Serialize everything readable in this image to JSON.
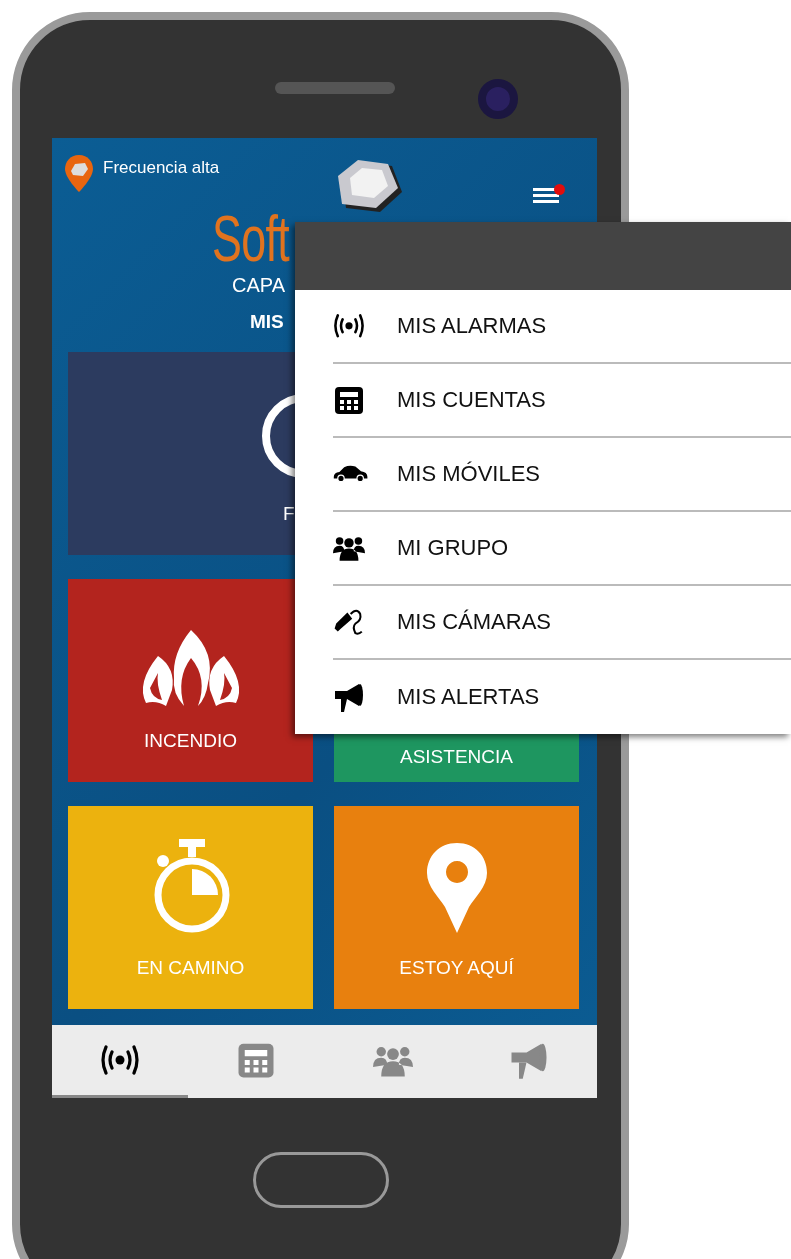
{
  "status": {
    "text": "Frecuencia alta",
    "notification_dot": true
  },
  "logo": {
    "text": "Soft",
    "subtitle": "CAPA"
  },
  "section_title": "MIS",
  "tiles": [
    {
      "kind": "wide",
      "label": "F",
      "color": "#2c3b5f"
    },
    {
      "kind": "fire",
      "label": "INCENDIO",
      "color": "#b3241e"
    },
    {
      "kind": "assist",
      "label": "ASISTENCIA",
      "color": "#1e9660"
    },
    {
      "kind": "timer",
      "label": "EN CAMINO",
      "color": "#ecb20e"
    },
    {
      "kind": "pin",
      "label": "ESTOY AQUÍ",
      "color": "#e8800e"
    }
  ],
  "bottom_nav": [
    {
      "kind": "alarm",
      "selected": true
    },
    {
      "kind": "accounts",
      "selected": false
    },
    {
      "kind": "group",
      "selected": false
    },
    {
      "kind": "alerts",
      "selected": false
    }
  ],
  "menu": {
    "items": [
      {
        "kind": "alarm",
        "label": "MIS ALARMAS"
      },
      {
        "kind": "accounts",
        "label": "MIS CUENTAS"
      },
      {
        "kind": "car",
        "label": "MIS MÓVILES"
      },
      {
        "kind": "group",
        "label": "MI GRUPO"
      },
      {
        "kind": "camera",
        "label": "MIS CÁMARAS"
      },
      {
        "kind": "alerts",
        "label": "MIS ALERTAS"
      }
    ]
  }
}
